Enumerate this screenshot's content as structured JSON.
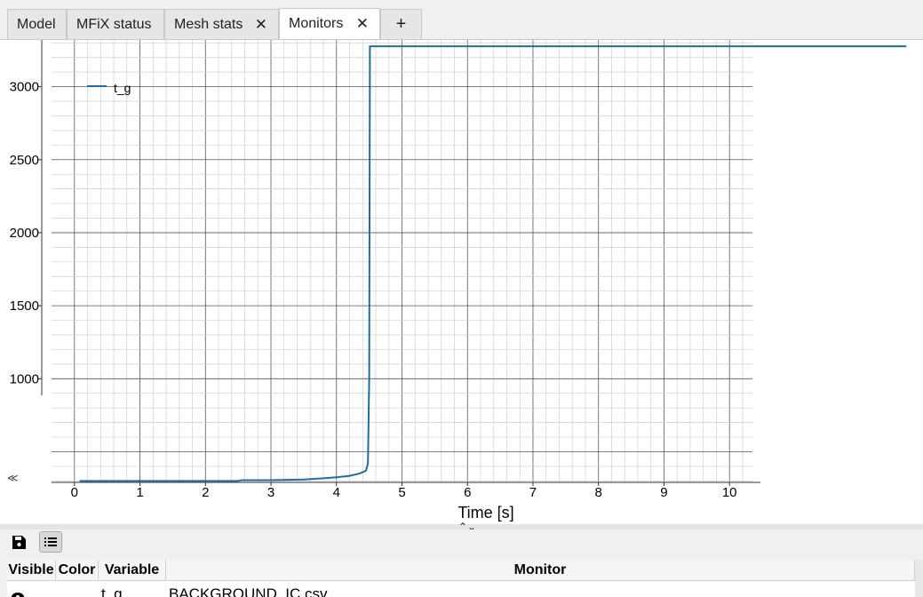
{
  "tabs": [
    {
      "label": "Model"
    },
    {
      "label": "MFiX status"
    },
    {
      "label": "Mesh stats",
      "closable": true
    },
    {
      "label": "Monitors",
      "closable": true,
      "active": true
    },
    {
      "label": "+"
    }
  ],
  "close_glyph": "✕",
  "chart_data": {
    "type": "line",
    "xlabel": "Time [s]",
    "ylabel": "",
    "x_ticks": [
      "0",
      "1",
      "2",
      "3",
      "4",
      "5",
      "6",
      "7",
      "8",
      "9",
      "10"
    ],
    "y_ticks": [
      "1000",
      "1500",
      "2000",
      "2500",
      "3000"
    ],
    "xlim": [
      -0.35,
      10.35
    ],
    "ylim": [
      290,
      3320
    ],
    "grid": true,
    "legend": "top-left",
    "series": [
      {
        "name": "t_g",
        "color": "#1f6e9c",
        "points": [
          [
            0.08,
            300
          ],
          [
            1,
            300
          ],
          [
            2,
            300
          ],
          [
            2.5,
            300
          ],
          [
            2.55,
            305
          ],
          [
            3,
            305
          ],
          [
            3.5,
            310
          ],
          [
            3.8,
            318
          ],
          [
            4.0,
            325
          ],
          [
            4.2,
            335
          ],
          [
            4.35,
            350
          ],
          [
            4.45,
            370
          ],
          [
            4.48,
            420
          ],
          [
            4.5,
            1000
          ],
          [
            4.51,
            3277
          ],
          [
            10.35,
            3277
          ],
          [
            12.7,
            3277
          ]
        ]
      }
    ]
  },
  "toolbar": {
    "save_icon": "save-icon",
    "list_icon": "list-icon"
  },
  "table": {
    "headers": [
      "Visible",
      "Color",
      "Variable",
      "Monitor"
    ],
    "rows": [
      {
        "variable": "t_g",
        "monitor": "BACKGROUND_IC.csv"
      }
    ]
  }
}
